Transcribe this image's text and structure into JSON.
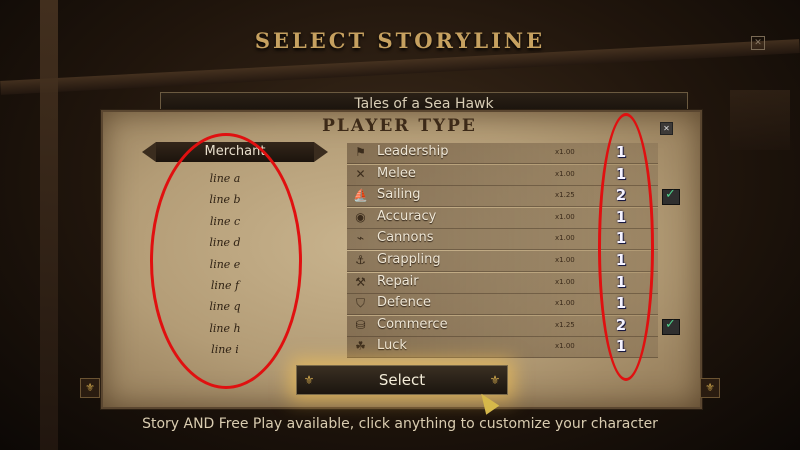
{
  "screen": {
    "title": "SELECT STORYLINE",
    "close_glyph": "✕",
    "storyline": "Tales of a Sea Hawk",
    "hint": "Story AND Free Play available, click anything to customize your character"
  },
  "panel": {
    "title": "PLAYER TYPE",
    "close_glyph": "✕",
    "player_type": "Merchant",
    "lines": [
      "line a",
      "line b",
      "line c",
      "line d",
      "line e",
      "line f",
      "line q",
      "line h",
      "line i"
    ],
    "select_label": "Select"
  },
  "skills": [
    {
      "name": "Leadership",
      "icon": "flag-icon",
      "glyph": "⚑",
      "mult": "x1.00",
      "level": "1",
      "checked": false
    },
    {
      "name": "Melee",
      "icon": "crossed-swords-icon",
      "glyph": "✕",
      "mult": "x1.00",
      "level": "1",
      "checked": false
    },
    {
      "name": "Sailing",
      "icon": "sail-icon",
      "glyph": "⛵",
      "mult": "x1.25",
      "level": "2",
      "checked": true
    },
    {
      "name": "Accuracy",
      "icon": "target-icon",
      "glyph": "◉",
      "mult": "x1.00",
      "level": "1",
      "checked": false
    },
    {
      "name": "Cannons",
      "icon": "cannon-icon",
      "glyph": "⌁",
      "mult": "x1.00",
      "level": "1",
      "checked": false
    },
    {
      "name": "Grappling",
      "icon": "grapple-hook-icon",
      "glyph": "⚓",
      "mult": "x1.00",
      "level": "1",
      "checked": false
    },
    {
      "name": "Repair",
      "icon": "hammer-icon",
      "glyph": "⚒",
      "mult": "x1.00",
      "level": "1",
      "checked": false
    },
    {
      "name": "Defence",
      "icon": "shield-icon",
      "glyph": "⛉",
      "mult": "x1.00",
      "level": "1",
      "checked": false
    },
    {
      "name": "Commerce",
      "icon": "coins-icon",
      "glyph": "⛁",
      "mult": "x1.25",
      "level": "2",
      "checked": true
    },
    {
      "name": "Luck",
      "icon": "clover-icon",
      "glyph": "☘",
      "mult": "x1.00",
      "level": "1",
      "checked": false
    }
  ],
  "colors": {
    "annotation": "#e01010",
    "check": "#4fd08c",
    "gold": "#c6a160"
  }
}
